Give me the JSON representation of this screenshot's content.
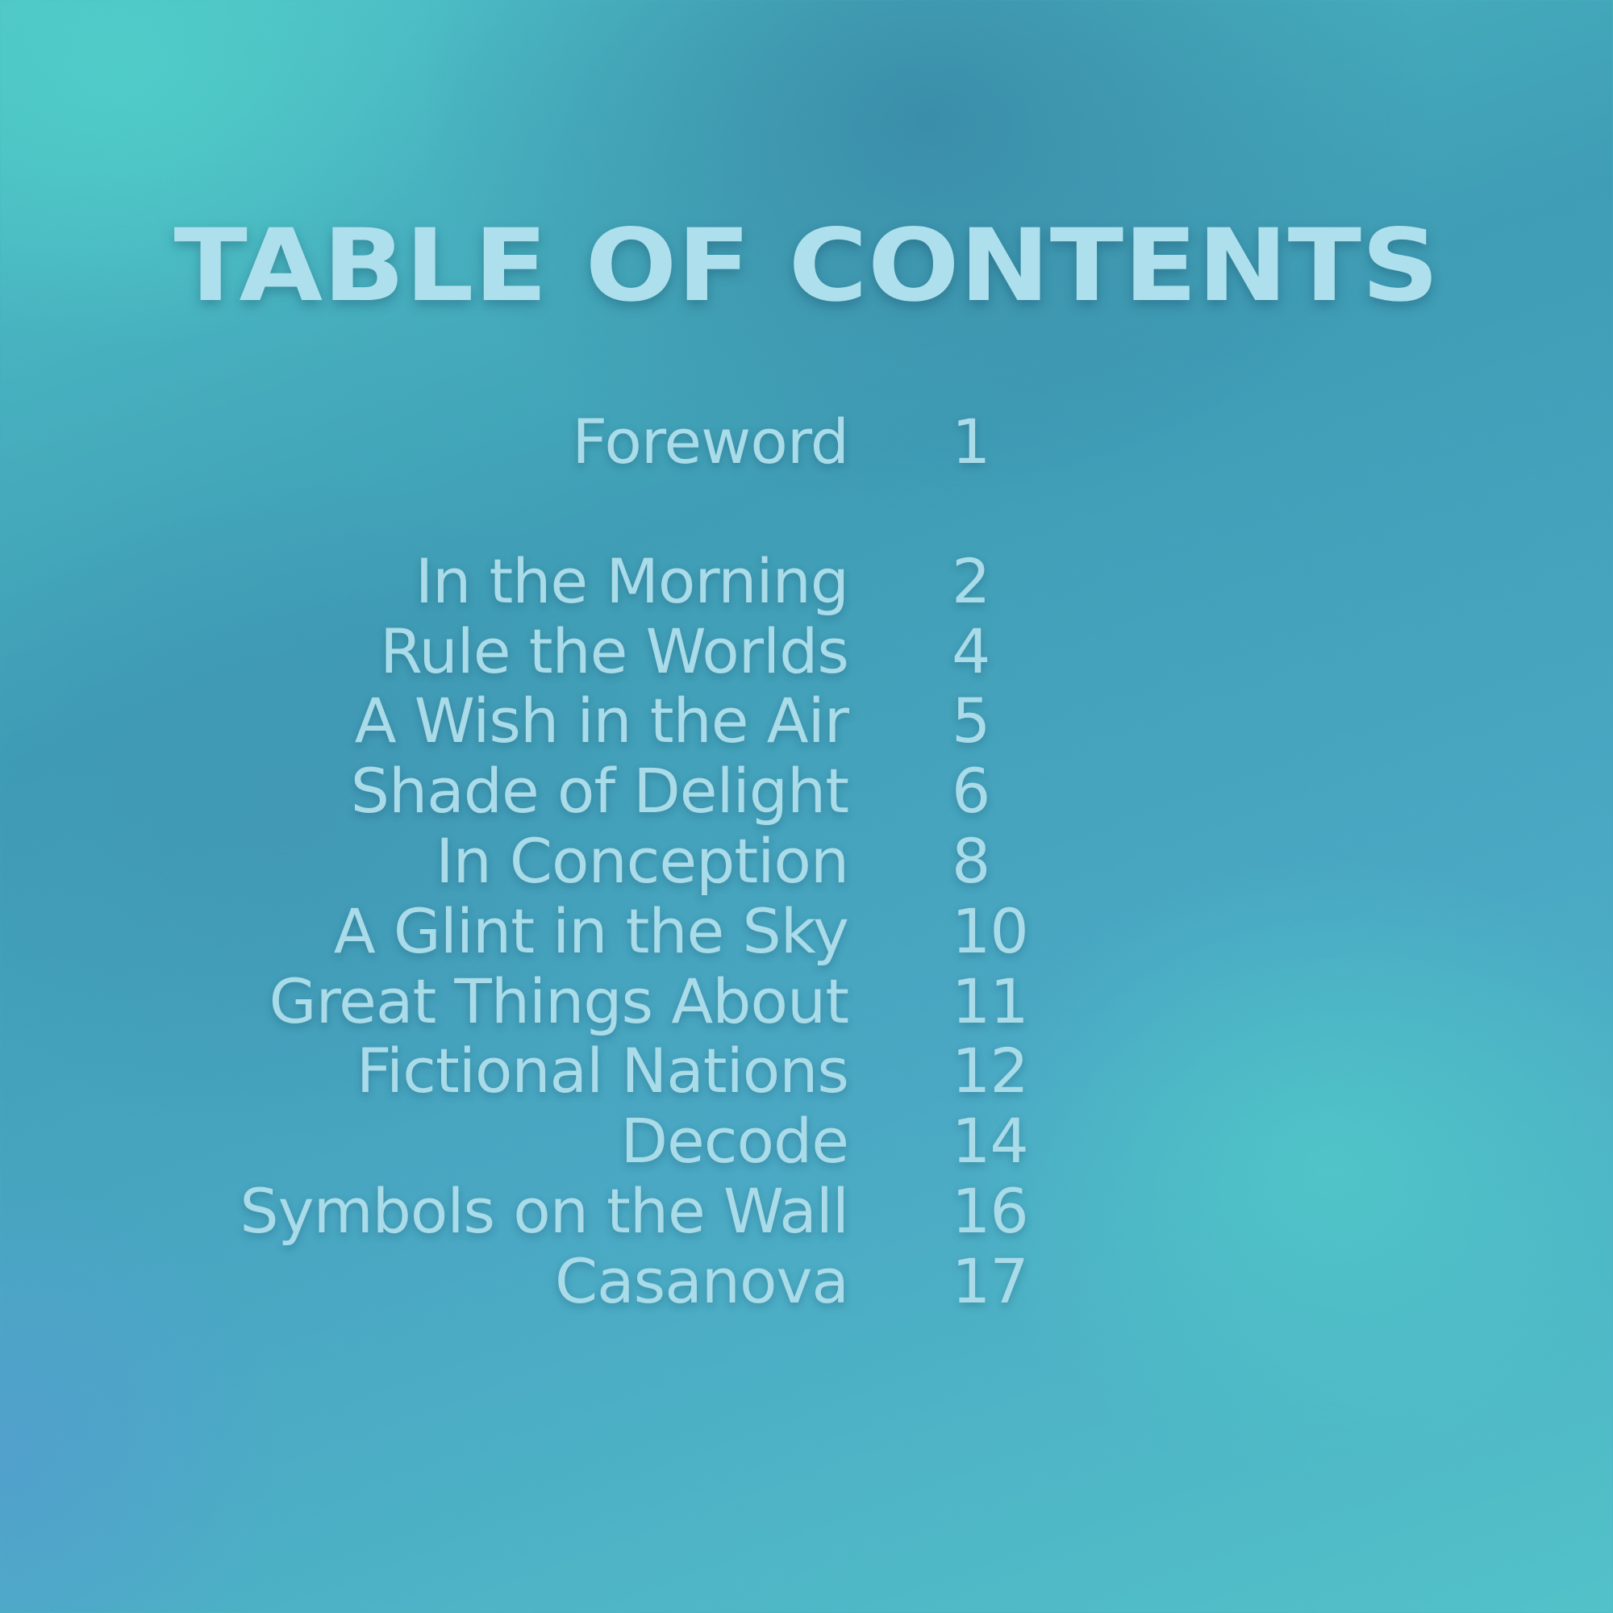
{
  "title": "TABLE OF CONTENTS",
  "entries": [
    {
      "title": "Foreword",
      "page": "1"
    },
    {
      "title": "In the Morning",
      "page": "2"
    },
    {
      "title": "Rule the Worlds",
      "page": "4"
    },
    {
      "title": "A Wish in the Air",
      "page": "5"
    },
    {
      "title": "Shade of Delight",
      "page": "6"
    },
    {
      "title": "In Conception",
      "page": "8"
    },
    {
      "title": "A Glint in the Sky",
      "page": "10"
    },
    {
      "title": "Great Things About",
      "page": "11"
    },
    {
      "title": "Fictional Nations",
      "page": "12"
    },
    {
      "title": "Decode",
      "page": "14"
    },
    {
      "title": "Symbols on the Wall",
      "page": "16"
    },
    {
      "title": "Casanova",
      "page": "17"
    }
  ],
  "colors": {
    "text": "#a9dbe8",
    "title": "#ade0ec",
    "background_teal": "#4fc4c8",
    "background_deep": "#3a8ca8"
  }
}
